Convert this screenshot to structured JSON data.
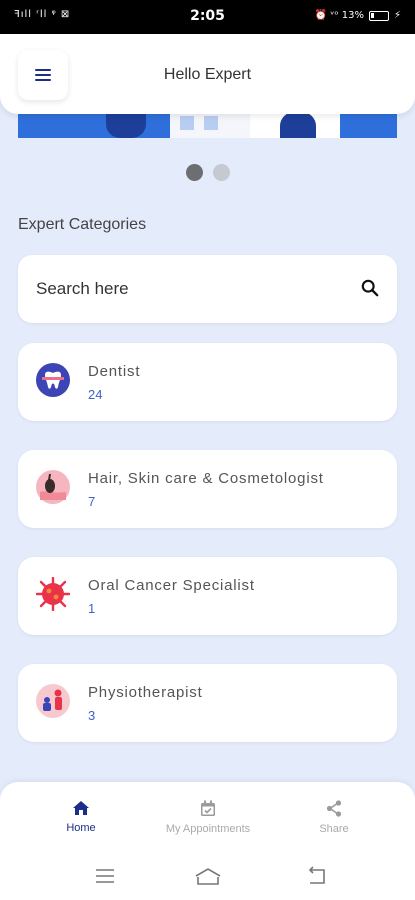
{
  "status_bar": {
    "left_text": "ꟻıll ʳll ᵠ ⊠",
    "time": "2:05",
    "right_text": "⏰ ᵛᵒ 13%",
    "charging": "⚡"
  },
  "header": {
    "title": "Hello Expert",
    "menu_icon": "hamburger-menu-icon"
  },
  "carousel": {
    "page_count": 2,
    "active_index": 0
  },
  "section": {
    "title": "Expert Categories"
  },
  "search": {
    "placeholder": "Search here",
    "icon": "search-icon"
  },
  "categories": [
    {
      "name": "Dentist",
      "count": "24",
      "icon": "tooth-icon"
    },
    {
      "name": "Hair, Skin care & Cosmetologist",
      "count": "7",
      "icon": "hair-follicle-icon"
    },
    {
      "name": "Oral Cancer Specialist",
      "count": "1",
      "icon": "virus-cell-icon"
    },
    {
      "name": "Physiotherapist",
      "count": "3",
      "icon": "physiotherapy-icon"
    }
  ],
  "bottom_nav": {
    "items": [
      {
        "label": "Home",
        "icon": "home-icon",
        "active": true
      },
      {
        "label": "My Appointments",
        "icon": "calendar-check-icon",
        "active": false
      },
      {
        "label": "Share",
        "icon": "share-icon",
        "active": false
      }
    ]
  },
  "colors": {
    "accent": "#1c2e8c",
    "count": "#3e63c7",
    "background": "#e4ebfb"
  }
}
